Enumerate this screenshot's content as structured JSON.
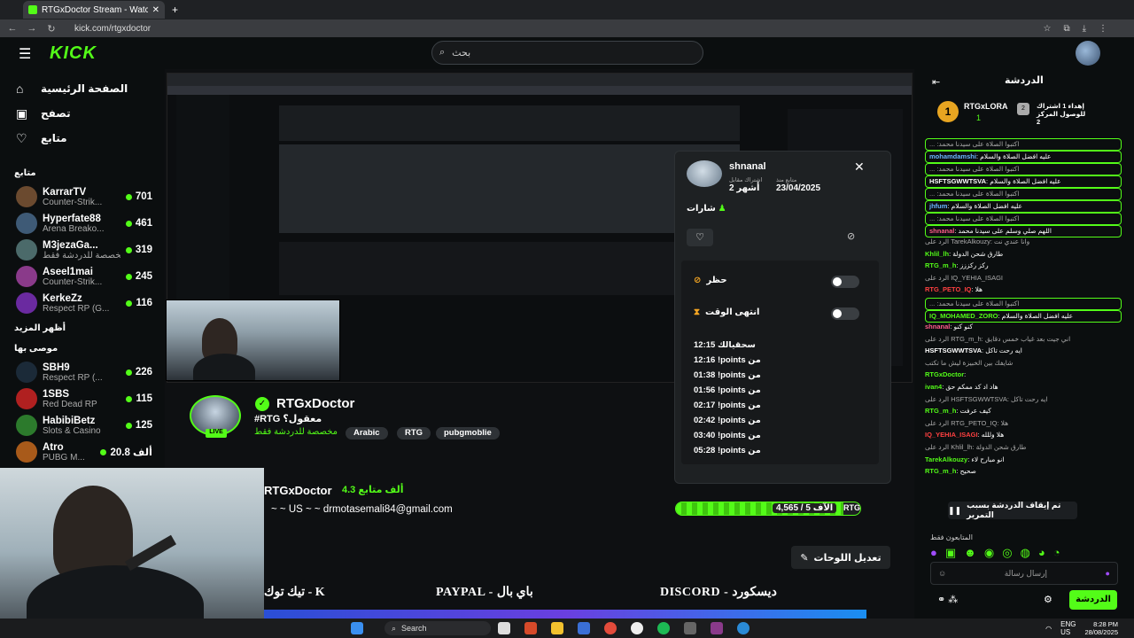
{
  "browser": {
    "tab_title": "RTGxDoctor Stream - Watch Live",
    "url": "kick.com/rtgxdoctor"
  },
  "nav": {
    "logo": "KICK",
    "search_placeholder": "بحث"
  },
  "sidebar": {
    "main": [
      {
        "label": "الصفحة الرئيسية",
        "icon": "home-icon"
      },
      {
        "label": "تصفح",
        "icon": "browse-icon"
      },
      {
        "label": "متابع",
        "icon": "heart-icon"
      }
    ],
    "following_heading": "متابع",
    "following": [
      {
        "name": "KarrarTV",
        "cat": "Counter-Strik...",
        "viewers": "701",
        "color": "#6b4a2f"
      },
      {
        "name": "Hyperfate88",
        "cat": "Arena Breako...",
        "viewers": "461",
        "color": "#3e5a76"
      },
      {
        "name": "M3jezaGa...",
        "cat": "مخصصة للدردشة فقط",
        "viewers": "319",
        "color": "#4b6a6a"
      },
      {
        "name": "Aseel1mai",
        "cat": "Counter-Strik...",
        "viewers": "245",
        "color": "#8a3a8a"
      },
      {
        "name": "KerkeZz",
        "cat": "Respect RP (G...",
        "viewers": "116",
        "color": "#6a2aa0"
      }
    ],
    "show_more": "أظهر المزيد",
    "recommended_heading": "موصى بها",
    "recommended": [
      {
        "name": "SBH9",
        "cat": "Respect RP (...",
        "viewers": "226",
        "color": "#1b2a38"
      },
      {
        "name": "1SBS",
        "cat": "Red Dead RP",
        "viewers": "115",
        "color": "#b02020"
      },
      {
        "name": "HabibiBetz",
        "cat": "Slots & Casino",
        "viewers": "125",
        "color": "#2c7a2c"
      },
      {
        "name": "Atro",
        "cat": "PUBG M...",
        "viewers": "20.8 ألف",
        "color": "#a85a1a"
      }
    ]
  },
  "channel": {
    "name": "RTGxDoctor",
    "title": "#RTG معقول؟",
    "category": "مخصصة للدردشة فقط",
    "tags": [
      "Arabic",
      "RTG",
      "pubgmoblie"
    ],
    "live": "LIVE",
    "followers": "4.3 ألف متابع",
    "contact": "~ ~ US ~ ~ drmotasemali84@gmail.com",
    "edit_panels": "تعديل اللوحات",
    "panels": [
      "تيك توك - K",
      "PAYPAL - باي بال",
      "DISCORD - ديسكورد"
    ],
    "goal_text": "4,565 / 5 الآف",
    "goal_fraction": 0.91,
    "goal_label": "RTG"
  },
  "modal": {
    "username": "shnanal",
    "sub_label": "اشتراك مقابل",
    "sub_value": "2 أشهر",
    "follow_label": "متابع منذ",
    "follow_value": "23/04/2025",
    "badges_label": "شارات",
    "ban_label": "حظر",
    "timeout_label": "انتهى الوقت",
    "log": [
      {
        "t": "12:15",
        "m": "سحقيالك"
      },
      {
        "t": "12:16",
        "m": "!points من"
      },
      {
        "t": "01:38",
        "m": "!points من"
      },
      {
        "t": "01:56",
        "m": "!points من"
      },
      {
        "t": "02:17",
        "m": "!points من"
      },
      {
        "t": "02:42",
        "m": "!points من"
      },
      {
        "t": "03:40",
        "m": "!points من"
      },
      {
        "t": "05:28",
        "m": "!points من"
      }
    ]
  },
  "chat": {
    "title": "الدردشة",
    "leader": {
      "rank": "1",
      "name": "RTGxLORA",
      "value": "1"
    },
    "gift": {
      "rank": "2",
      "text": "إهداء 1 اشتراك للوصول المركز 2"
    },
    "messages": [
      {
        "text": "... :اكتبوا الصلاة على سيدنا محمد",
        "boxed": true
      },
      {
        "user": "mohamdamshi",
        "text": "عليه افضل الصلاة والسلام",
        "boxed": true,
        "ucolor": "#6ab7ff"
      },
      {
        "text": "... :اكتبوا الصلاة على سيدنا محمد",
        "boxed": true
      },
      {
        "user": "HSFTSGWWTSVA",
        "text": "عليه افضل الصلاة والسلام",
        "boxed": true,
        "ucolor": "#ffffff"
      },
      {
        "text": "... :اكتبوا الصلاة على سيدنا محمد",
        "boxed": true
      },
      {
        "user": "jhfum",
        "text": "عليه افضل الصلاة والسلام",
        "boxed": true,
        "ucolor": "#6ab7ff"
      },
      {
        "text": "... :اكتبوا الصلاة على سيدنا محمد",
        "boxed": true
      },
      {
        "user": "shnanal",
        "text": "اللهم صلي وسلم على سيدنا محمد",
        "boxed": true,
        "ucolor": "#ff5c8a"
      },
      {
        "text": "الرد على TarekAlkouzy: وانا عندي نت"
      },
      {
        "user": "Khlil_lh",
        "text": "طارق شحن الدولة",
        "ucolor": "#53fc18"
      },
      {
        "user": "RTG_m_h",
        "text": "ركز ركززز",
        "ucolor": "#53fc18"
      },
      {
        "text": "الرد على IQ_YEHIA_ISAGI"
      },
      {
        "user": "RTG_PETO_IQ",
        "text": "هلا",
        "ucolor": "#ff4040"
      },
      {
        "text": "... :اكتبوا الصلاة على سيدنا محمد",
        "boxed": true
      },
      {
        "user": "IQ_MOHAMED_ZORO",
        "text": "عليه افضل الصلاة والسلام",
        "boxed": true,
        "ucolor": "#53fc18"
      },
      {
        "user": "shnanal",
        "text": "كنو كنو",
        "ucolor": "#ff5c8a"
      },
      {
        "text": "الرد على RTG_m_h: اني جيت بعد غياب خمس دقايق"
      },
      {
        "user": "HSFTSGWWTSVA",
        "text": "ايه رحت تاكل",
        "ucolor": "#ffffff"
      },
      {
        "text": "شايفك بين الخبيزة ليش ما تكتب"
      },
      {
        "user": "RTGxDoctor",
        "text": "",
        "ucolor": "#53fc18"
      },
      {
        "user": "ivan4",
        "text": "هاد اد كد ممكم حق",
        "ucolor": "#53fc18"
      },
      {
        "text": "الرد على HSFTSGWWTSVA: ايه رحت تاكل"
      },
      {
        "user": "RTG_m_h",
        "text": "كيف عرفت",
        "ucolor": "#53fc18"
      },
      {
        "text": "الرد على RTG_PETO_IQ: هلا"
      },
      {
        "user": "IQ_YEHIA_ISAGI",
        "text": "هلا وللله",
        "ucolor": "#ff4040"
      },
      {
        "text": "الرد على Khlil_lh: طارق شحن الدولة"
      },
      {
        "user": "TarekAlkouzy",
        "text": "انو مبارح لاء",
        "ucolor": "#53fc18"
      },
      {
        "user": "RTG_m_h",
        "text": "صحيح",
        "ucolor": "#53fc18"
      }
    ],
    "paused": "تم إيقاف الدردشة بسبب التمرير",
    "subs_only": "المتابعون فقط",
    "input_placeholder": "إرسال رسالة",
    "chat_button": "الدردشة"
  },
  "taskbar": {
    "search": "Search",
    "lang": "ENG\nUS",
    "time": "8:28 PM",
    "date": "28/08/2025"
  }
}
